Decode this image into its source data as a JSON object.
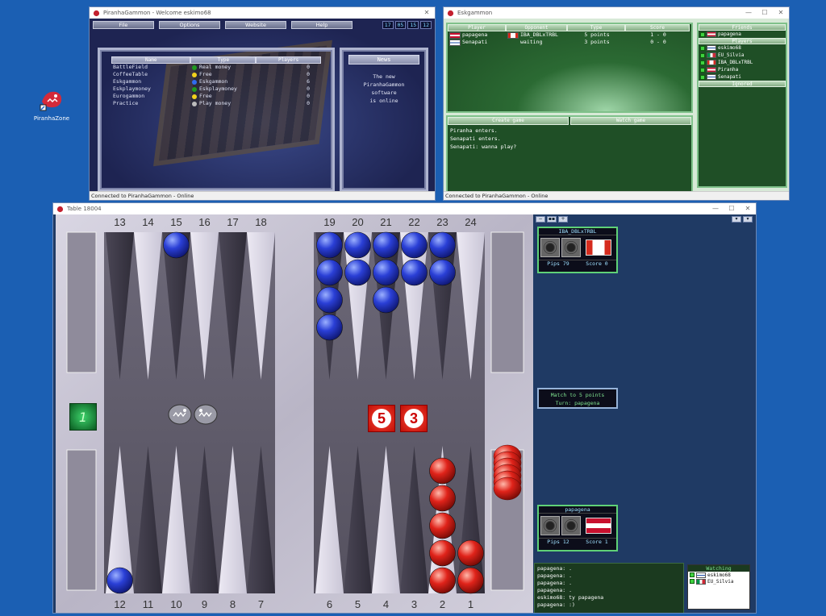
{
  "desktop": {
    "icon_label": "PiranhaZone"
  },
  "lobby": {
    "title": "PiranhaGammon - Welcome eskimo68",
    "menu": [
      "File",
      "Options",
      "Website",
      "Help"
    ],
    "clock": [
      "17",
      "05",
      "15",
      "12"
    ],
    "columns": [
      "Name",
      "Type",
      "Players"
    ],
    "rooms": [
      {
        "name": "BattleField",
        "type": "Real money",
        "players": "0",
        "dot": "#1f9a1f"
      },
      {
        "name": "CoffeeTable",
        "type": "Free",
        "players": "0",
        "dot": "#f2d21c"
      },
      {
        "name": "Eskgammon",
        "type": "Eskgammon",
        "players": "6",
        "dot": "#2f6cf0"
      },
      {
        "name": "Eskplaymoney",
        "type": "Eskplaymoney",
        "players": "0",
        "dot": "#1f9a1f"
      },
      {
        "name": "Eurogammon",
        "type": "Free",
        "players": "0",
        "dot": "#f2d21c"
      },
      {
        "name": "Practice",
        "type": "Play money",
        "players": "0",
        "dot": "#bcbcbc"
      }
    ],
    "news_title": "News",
    "news_lines": [
      "The new",
      "PiranhaGammon",
      "software",
      "is online"
    ],
    "status": "Connected to PiranhaGammon - Online"
  },
  "esk": {
    "title": "Eskgammon",
    "columns": [
      "Player",
      "Opponent",
      "Type",
      "Score"
    ],
    "games": [
      {
        "player": "papagena",
        "opponent": "IBA_DBLxTRBL",
        "type": "5 points",
        "score": "1 -  0"
      },
      {
        "player": "Senapati",
        "opponent": "waiting",
        "type": "3 points",
        "score": "0 -  0"
      }
    ],
    "buttons": [
      "Create game",
      "Watch game"
    ],
    "chat": [
      "Piranha enters.",
      "Senapati enters.",
      "Senapati: wanna play?"
    ],
    "friends_head": "Friends",
    "friends": [
      "papagena"
    ],
    "players_head": "Players",
    "players": [
      "eskimo68",
      "EU_Silvia",
      "IBA_DBLxTRBL",
      "Piranha",
      "Senapati"
    ],
    "ignored_head": "Ignored",
    "status": "Connected to PiranhaGammon - Online"
  },
  "table": {
    "title": "Table 18004",
    "top_numbers": [
      "13",
      "14",
      "15",
      "16",
      "17",
      "18",
      "19",
      "20",
      "21",
      "22",
      "23",
      "24"
    ],
    "bottom_numbers": [
      "12",
      "11",
      "10",
      "9",
      "8",
      "7",
      "6",
      "5",
      "4",
      "3",
      "2",
      "1"
    ],
    "dice": [
      "5",
      "3"
    ],
    "cube": "1",
    "opponent": {
      "name": "IBA_DBLxTRBL",
      "pips": "Pips 79",
      "score": "Score 0"
    },
    "player": {
      "name": "papagena",
      "pips": "Pips 12",
      "score": "Score 1"
    },
    "match_line1": "Match to 5 points",
    "match_line2": "Turn: papagena",
    "chat": [
      "papagena: .",
      "papagena: .",
      "papagena: .",
      "papagena: .",
      "eskimo68: ty papagena",
      "papagena: :)"
    ],
    "watching_head": "Watching",
    "watching": [
      "eskimo68",
      "EU_Silvia"
    ]
  },
  "colors": {
    "desktop": "#1b5fb3",
    "esk_green": "#1f4f26",
    "blue_checker": "#2a3fd6",
    "red_checker": "#e0231a"
  }
}
